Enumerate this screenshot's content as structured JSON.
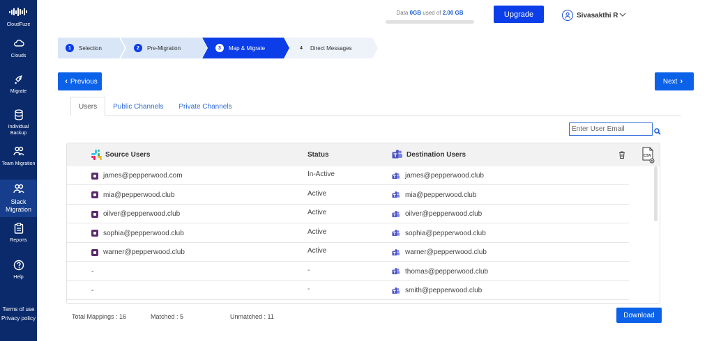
{
  "brand": {
    "name": "CloudFuze"
  },
  "sidebar": {
    "items": [
      {
        "label": "Clouds",
        "icon": "cloud-icon"
      },
      {
        "label": "Migrate",
        "icon": "rocket-icon"
      },
      {
        "label": "Individual Backup",
        "icon": "database-icon"
      },
      {
        "label": "Team Migration",
        "icon": "users-icon"
      },
      {
        "label": "Slack Migration",
        "icon": "users-icon",
        "active": true
      },
      {
        "label": "Reports",
        "icon": "clipboard-icon"
      },
      {
        "label": "Help",
        "icon": "help-icon"
      }
    ],
    "footer": {
      "terms": "Terms of use",
      "privacy": "Privacy policy"
    }
  },
  "header": {
    "quota_prefix": "Data ",
    "quota_used": "0GB",
    "quota_middle": " used of ",
    "quota_total": "2.00 GB",
    "quota_fraction": 0.0,
    "upgrade_label": "Upgrade",
    "user_name": "Sivasakthi R"
  },
  "steps": [
    {
      "num": "1",
      "label": "Selection"
    },
    {
      "num": "2",
      "label": "Pre-Migration"
    },
    {
      "num": "3",
      "label": "Map & Migrate",
      "active": true
    },
    {
      "num": "4",
      "label": "Direct Messages"
    }
  ],
  "nav": {
    "previous": "Previous",
    "next": "Next"
  },
  "tabs": [
    {
      "label": "Users",
      "active": true
    },
    {
      "label": "Public Channels"
    },
    {
      "label": "Private Channels"
    }
  ],
  "search": {
    "placeholder": "Enter User Email"
  },
  "table": {
    "headers": {
      "source": "Source Users",
      "status": "Status",
      "destination": "Destination Users"
    },
    "rows": [
      {
        "source": "james@pepperwood.com",
        "status": "In-Active",
        "destination": "james@pepperwood.club"
      },
      {
        "source": "mia@pepperwood.club",
        "status": "Active",
        "destination": "mia@pepperwood.club"
      },
      {
        "source": "oilver@pepperwood.club",
        "status": "Active",
        "destination": "oilver@pepperwood.club"
      },
      {
        "source": "sophia@pepperwood.club",
        "status": "Active",
        "destination": "sophia@pepperwood.club"
      },
      {
        "source": "warner@pepperwood.club",
        "status": "Active",
        "destination": "warner@pepperwood.club"
      },
      {
        "source": "-",
        "status": "-",
        "destination": "thomas@pepperwood.club"
      },
      {
        "source": "-",
        "status": "-",
        "destination": "smith@pepperwood.club"
      }
    ]
  },
  "footer": {
    "total": "Total Mappings : 16",
    "matched": "Matched : 5",
    "unmatched": "Unmatched : 11",
    "download": "Download"
  },
  "colors": {
    "sidebar": "#0a2a6b",
    "accent": "#0b3ee8",
    "button": "#0b62e8",
    "slack": "#5b2b6e",
    "teams": "#5059c9"
  }
}
